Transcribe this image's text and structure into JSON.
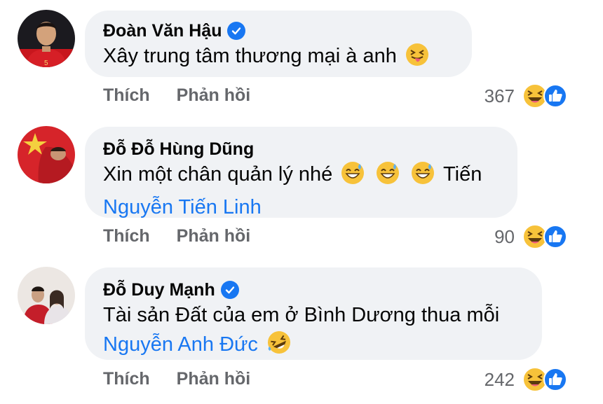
{
  "comments": [
    {
      "author": "Đoàn Văn Hậu",
      "verified": true,
      "text": "Xây trung tâm thương mại à anh",
      "emojis": [
        "squinting-tongue-emoji"
      ],
      "mention": "",
      "actions": {
        "like": "Thích",
        "reply": "Phản hồi"
      },
      "reaction_count": "367",
      "reaction_icons": [
        "haha-icon",
        "like-icon"
      ]
    },
    {
      "author": "Đỗ Đỗ Hùng Dũng",
      "verified": false,
      "text": "Xin một chân quản lý nhé",
      "emojis": [
        "grinning-sweat-emoji",
        "grinning-sweat-emoji",
        "grinning-sweat-emoji"
      ],
      "text_after_emojis": "Tiến",
      "mention": "Nguyễn Tiến Linh",
      "actions": {
        "like": "Thích",
        "reply": "Phản hồi"
      },
      "reaction_count": "90",
      "reaction_icons": [
        "haha-icon",
        "like-icon"
      ]
    },
    {
      "author": "Đỗ Duy Mạnh",
      "verified": true,
      "text": "Tài sản Đất của em ở Bình Dương thua mỗi",
      "mention": "Nguyễn Anh Đức",
      "emojis": [
        "rolling-laughing-emoji"
      ],
      "actions": {
        "like": "Thích",
        "reply": "Phản hồi"
      },
      "reaction_count": "242",
      "reaction_icons": [
        "haha-icon",
        "like-icon"
      ]
    }
  ],
  "colors": {
    "bubble": "#f0f2f5",
    "link": "#1877f2",
    "muted": "#65676b",
    "verified": "#1877f2"
  }
}
